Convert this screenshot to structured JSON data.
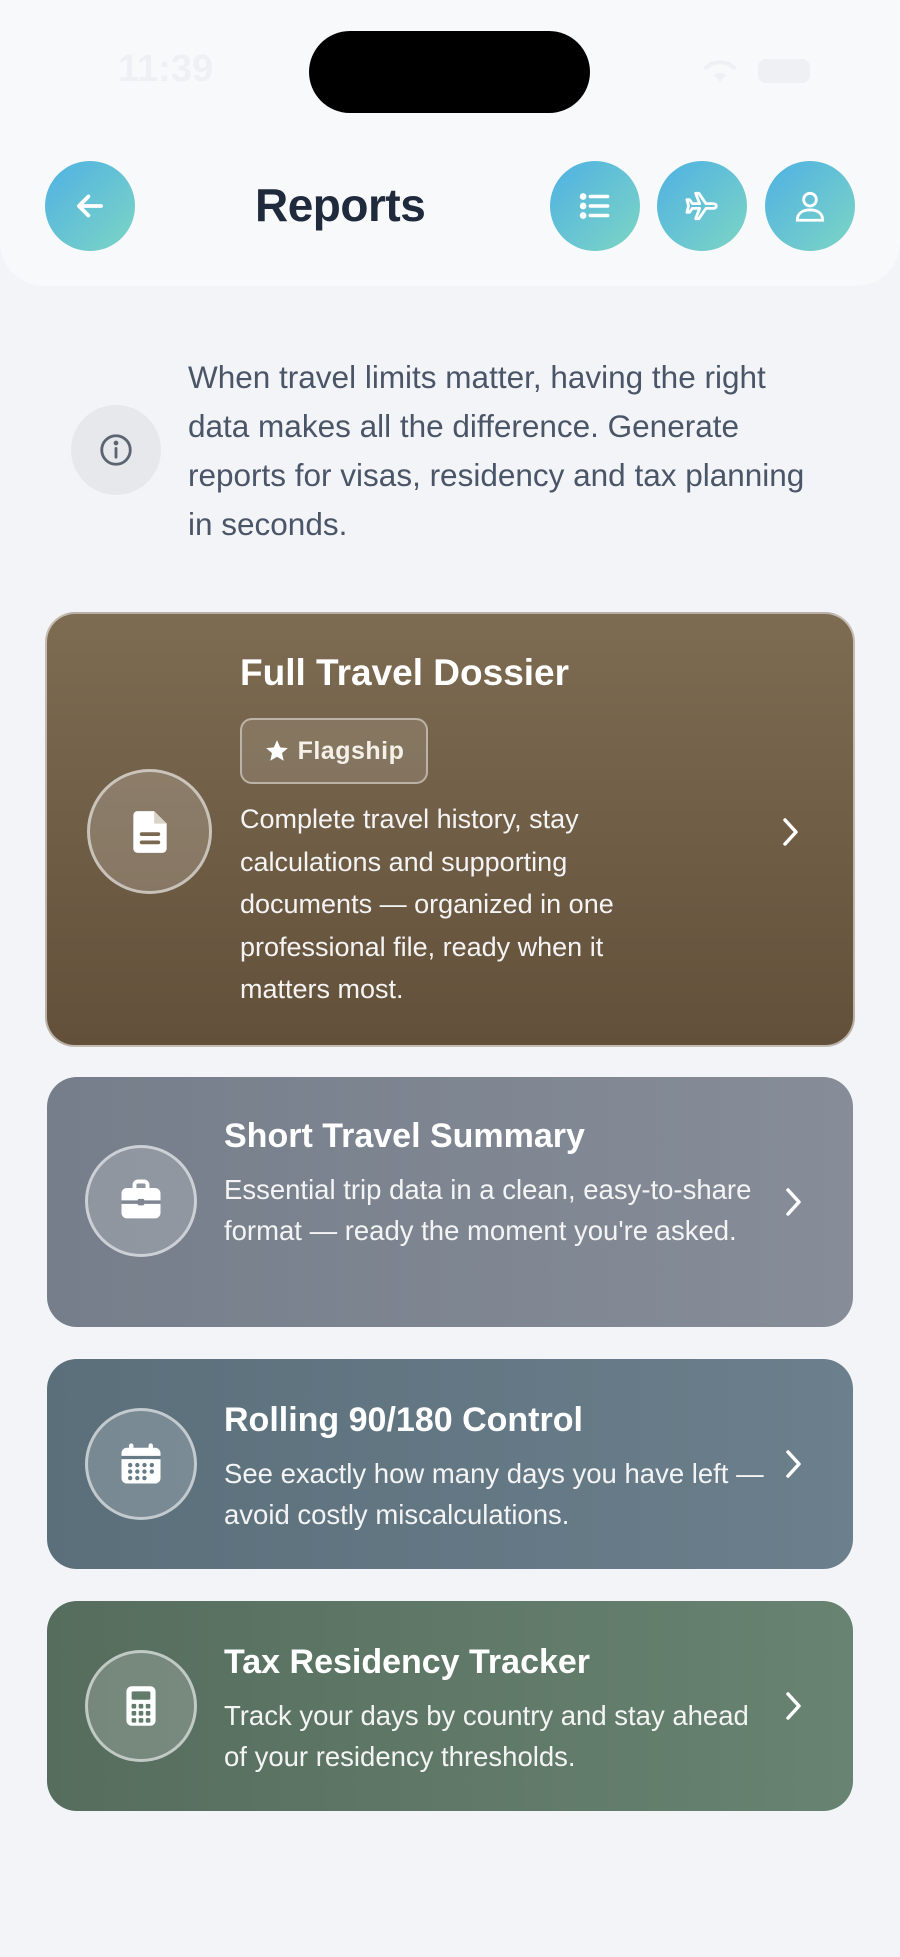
{
  "status_bar": {
    "time": "11:39"
  },
  "header": {
    "title": "Reports",
    "back_icon": "arrow-left-icon",
    "actions": [
      {
        "icon": "list-icon"
      },
      {
        "icon": "airplane-icon"
      },
      {
        "icon": "user-icon"
      }
    ],
    "accent_gradient": [
      "#4fb1e3",
      "#7dd5c4"
    ]
  },
  "intro": {
    "icon": "info-icon",
    "text": "When travel limits matter, having the right data makes all the difference. Generate reports for visas, residency and tax planning in seconds."
  },
  "reports": [
    {
      "title": "Full Travel Dossier",
      "badge": "Flagship",
      "badge_icon": "star-icon",
      "icon": "document-icon",
      "description": "Complete travel history, stay calculations and supporting documents — organized in one professional file, ready when it matters most.",
      "color": "#705e46"
    },
    {
      "title": "Short Travel Summary",
      "icon": "briefcase-icon",
      "description": "Essential trip data in a clean, easy-to-share format — ready the moment you're asked.",
      "color": "#7e8591"
    },
    {
      "title": "Rolling 90/180 Control",
      "icon": "calendar-icon",
      "description": "See exactly how many days you have left — avoid costly miscalculations.",
      "color": "#637783"
    },
    {
      "title": "Tax Residency Tracker",
      "icon": "calculator-icon",
      "description": "Track your days by country and stay ahead of your residency thresholds.",
      "color": "#5f7867"
    }
  ]
}
